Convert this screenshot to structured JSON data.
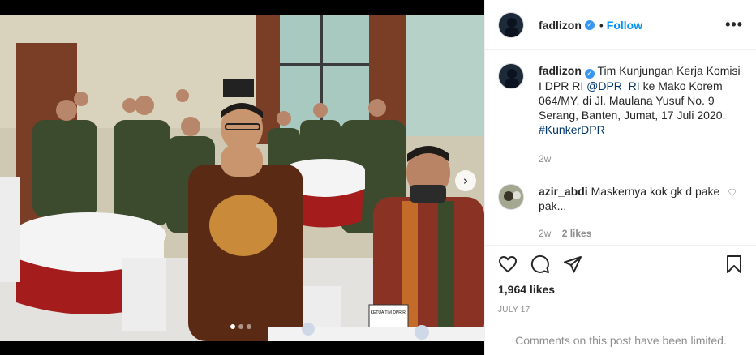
{
  "header": {
    "username": "fadlizon",
    "separator": "•",
    "follow_label": "Follow",
    "more_label": "•••"
  },
  "caption": {
    "username": "fadlizon",
    "text_part1": " Tim Kunjungan Kerja Komisi I DPR RI ",
    "mention": "@DPR_RI",
    "text_part2": " ke Mako Korem 064/MY, di Jl. Maulana Yusuf No. 9 Serang, Banten, Jumat, 17 Juli 2020. ",
    "hashtag": "#KunkerDPR",
    "time": "2w"
  },
  "comment": {
    "username": "azir_abdi",
    "text": " Maskernya kok gk d pake pak...",
    "time": "2w",
    "likes": "2 likes"
  },
  "post": {
    "likes": "1,964 likes",
    "date": "July 17",
    "comments_limited": "Comments on this post have been limited."
  },
  "photo": {
    "banner_text": "KETUA TIM DPR RI"
  },
  "icons": {
    "verified": "verified-badge-icon",
    "heart": "heart-icon",
    "comment": "comment-icon",
    "share": "share-icon",
    "bookmark": "bookmark-icon",
    "next": "chevron-right-icon"
  },
  "colors": {
    "follow": "#0095f6",
    "verified": "#3897f0",
    "link": "#00376b",
    "muted": "#8e8e8e"
  }
}
